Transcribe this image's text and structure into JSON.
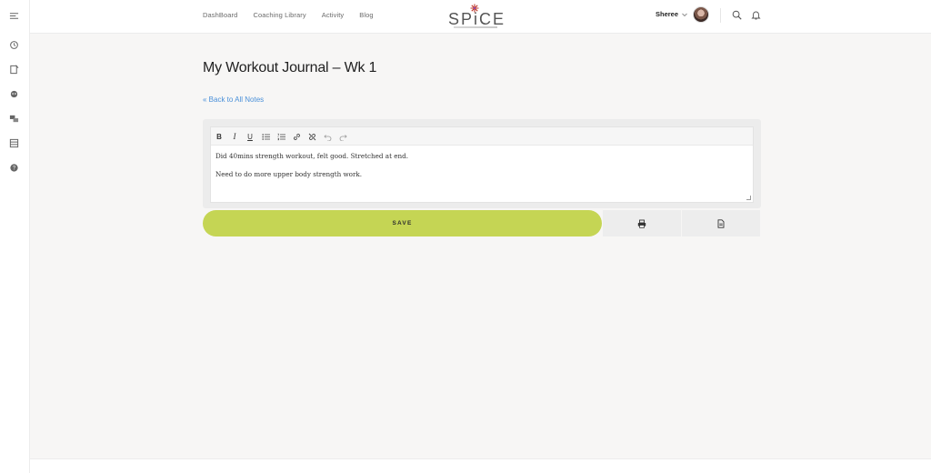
{
  "sidebar": {
    "items": [
      {
        "icon": "menu-icon"
      },
      {
        "icon": "history-icon"
      },
      {
        "icon": "notes-icon"
      },
      {
        "icon": "groups-icon"
      },
      {
        "icon": "messages-icon"
      },
      {
        "icon": "library-icon"
      },
      {
        "icon": "help-icon"
      }
    ]
  },
  "header": {
    "nav": [
      {
        "label": "DashBoard"
      },
      {
        "label": "Coaching Library"
      },
      {
        "label": "Activity"
      },
      {
        "label": "Blog"
      }
    ],
    "logo_text": "SPiCE",
    "user_name": "Sheree"
  },
  "page": {
    "title": "My Workout Journal – Wk 1",
    "back_link": "« Back to All Notes"
  },
  "editor": {
    "toolbar": [
      "bold",
      "italic",
      "underline",
      "bullet-list",
      "numbered-list",
      "link",
      "unlink",
      "undo",
      "redo"
    ],
    "lines": [
      "Did 40mins strength workout, felt good. Stretched at end.",
      "Need to do more upper body strength work."
    ]
  },
  "actions": {
    "save_label": "SAVE",
    "accent": "#c5d554"
  }
}
